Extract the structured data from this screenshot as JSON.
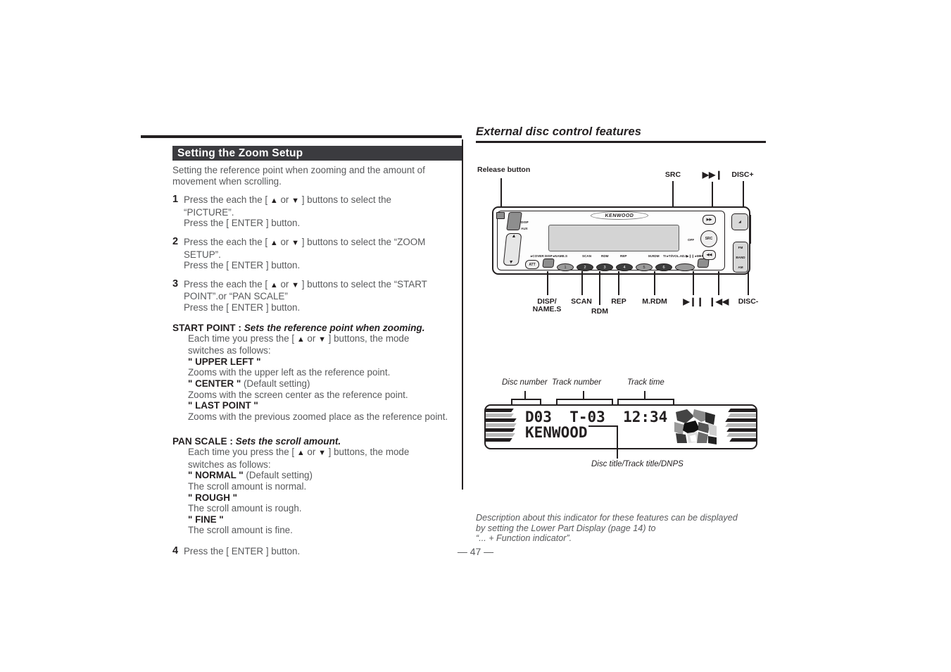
{
  "left": {
    "section_title": "Setting the Zoom Setup",
    "intro": "Setting the reference point when zooming and the amount of movement when scrolling.",
    "steps": [
      {
        "num": "1",
        "line1_a": "Press the each the [ ",
        "line1_b": " or ",
        "line1_c": " ] buttons to select the",
        "line2": "“PICTURE”.",
        "line3": "Press the [ ENTER ] button."
      },
      {
        "num": "2",
        "line1_a": "Press the each the [ ",
        "line1_b": " or ",
        "line1_c": " ] buttons to select the “ZOOM",
        "line2": "SETUP”.",
        "line3": "Press the [ ENTER ] button."
      },
      {
        "num": "3",
        "line1_a": "Press the each the [ ",
        "line1_b": " or ",
        "line1_c": " ] buttons to select the “START",
        "line2": "POINT”.or “PAN SCALE”",
        "line3": "Press the [ ENTER ] button."
      },
      {
        "num": "4",
        "line1_a": "Press the [ ENTER ] button.",
        "line1_b": "",
        "line1_c": "",
        "line2": "",
        "line3": ""
      }
    ],
    "start_point": {
      "term": "START POINT :",
      "definition": "Sets the reference point when zooming.",
      "body_a": "Each time you press the [ ",
      "body_b": " or ",
      "body_c": " ] buttons, the mode",
      "body_2": "switches as follows:",
      "options": [
        {
          "key": "\" UPPER LEFT \"",
          "note": "",
          "desc": "Zooms with the upper left as the reference point."
        },
        {
          "key": "\" CENTER \"",
          "note": "(Default setting)",
          "desc": "Zooms with the screen center as the reference point."
        },
        {
          "key": "\" LAST POINT \"",
          "note": "",
          "desc": "Zooms with the previous zoomed place as the reference point."
        }
      ]
    },
    "pan_scale": {
      "term": "PAN SCALE :",
      "definition": "Sets the scroll amount.",
      "body_a": "Each time you press the [ ",
      "body_b": " or ",
      "body_c": " ] buttons, the mode",
      "body_2": "switches as follows:",
      "options": [
        {
          "key": "\" NORMAL \"",
          "note": "(Default setting)",
          "desc": "The scroll amount is normal."
        },
        {
          "key": "\" ROUGH \"",
          "note": "",
          "desc": "The scroll amount is rough."
        },
        {
          "key": "\" FINE \"",
          "note": "",
          "desc": "The scroll amount is fine."
        }
      ]
    },
    "up_arrow": "▲",
    "down_arrow": "▼"
  },
  "right": {
    "title": "External disc control features",
    "callouts_top": [
      {
        "name": "release-button",
        "label": "Release button"
      },
      {
        "name": "src",
        "label": "SRC"
      },
      {
        "name": "fast-forward",
        "label": "▶▶❙"
      },
      {
        "name": "disc-plus",
        "label": "DISC+"
      }
    ],
    "callouts_bottom": [
      {
        "name": "disp-name-s",
        "label_line1": "DISP/",
        "label_line2": "NAME.S"
      },
      {
        "name": "scan",
        "label_line1": "SCAN",
        "label_line2": ""
      },
      {
        "name": "rdm",
        "label_line1": "RDM",
        "label_line2": ""
      },
      {
        "name": "rep",
        "label_line1": "REP",
        "label_line2": ""
      },
      {
        "name": "m-rdm",
        "label_line1": "M.RDM",
        "label_line2": ""
      },
      {
        "name": "play-pause",
        "label_line1": "▶❙❙",
        "label_line2": ""
      },
      {
        "name": "previous-track",
        "label_line1": "❙◀◀",
        "label_line2": ""
      },
      {
        "name": "disc-minus",
        "label_line1": "DISC-",
        "label_line2": ""
      }
    ],
    "faceplate": {
      "brand": "KENWOOD",
      "src_knob": "SRC",
      "off_label": "OFF",
      "att_label": "ATT",
      "preset_labels": [
        "1",
        "2",
        "3",
        "4",
        "5",
        "6"
      ],
      "micro_labels": [
        "▸COVER   DISP ▸NAME.S",
        "SCAN",
        "RDM",
        "REP",
        "M.RDM",
        "TI  ▸TI/VOL.ADJ",
        "▶❙❙ ▸MENU"
      ],
      "side_labels": [
        "FM",
        "+",
        "BAND",
        "−",
        "AM"
      ],
      "disp_label": "DISP",
      "aux_label": "AUX"
    },
    "display": {
      "callout_disc_number": "Disc number",
      "callout_track_number": "Track number",
      "callout_track_time": "Track time",
      "callout_title": "Disc title/Track title/DNPS",
      "disc_number": "D03",
      "track_number": "T-03",
      "track_time": "12:34",
      "title_text": "KENWOOD"
    },
    "footer_note_line1": "Description about this indicator for these features can be displayed",
    "footer_note_line2": "by setting the Lower Part Display (page 14) to",
    "footer_note_line3": "“... + Function indicator”."
  },
  "page_number": "— 47 —",
  "colors": {
    "ink": "#231f20",
    "body_text": "#58595b",
    "header_bar": "#3b3b3f",
    "lcd_fill": "#d4d4d4"
  }
}
